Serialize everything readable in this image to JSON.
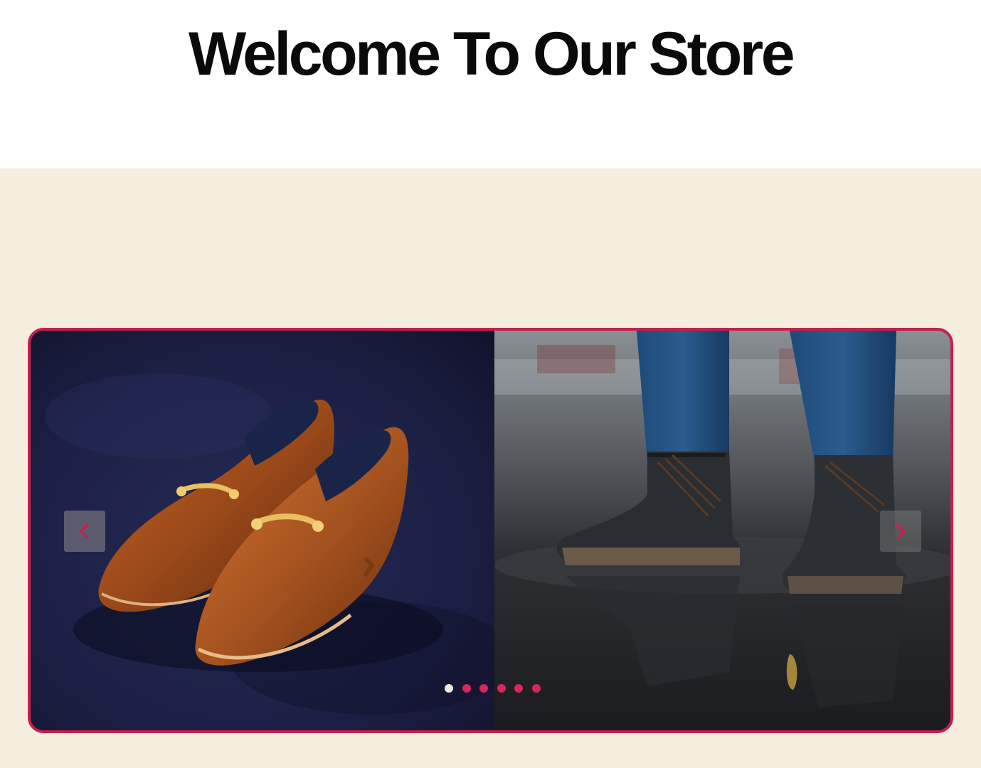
{
  "page": {
    "title": "Welcome To Our Store"
  },
  "colors": {
    "page_background": "#ffffff",
    "hero_background": "#f5eddd",
    "accent": "#c81e4c",
    "dot_active": "#ede8dc",
    "dot_inactive": "#d9265c",
    "nav_arrow": "#c81e4c"
  },
  "carousel": {
    "slides": [
      {
        "name": "brown-leather-horsebit-loafers",
        "icon": "loafers-image"
      },
      {
        "name": "black-boots-in-puddle",
        "icon": "boots-image"
      }
    ],
    "prev_icon": "chevron-left-icon",
    "next_icon": "chevron-right-icon",
    "indicator_count": 6,
    "active_index": 0
  }
}
